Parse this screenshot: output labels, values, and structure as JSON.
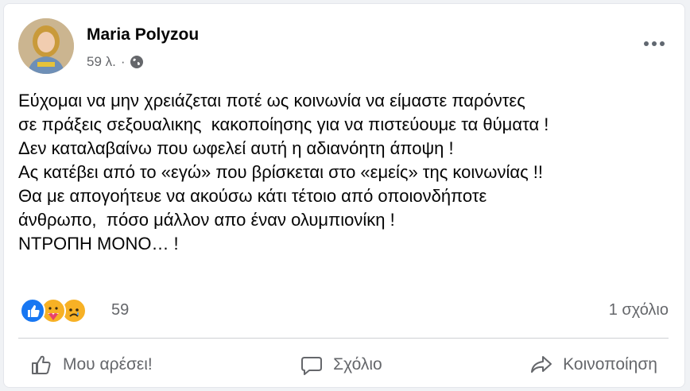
{
  "post": {
    "author": "Maria Polyzou",
    "time": "59 λ.",
    "separator": "·",
    "privacy_icon": "globe-icon",
    "text_lines": [
      "Εύχομαι να μην χρειάζεται ποτέ ως κοινωνία να είμαστε παρόντες",
      "σε πράξεις σεξουαλικης  κακοποίησης για να πιστεύουμε τα θύματα !",
      "Δεν καταλαβαίνω που ωφελεί αυτή η αδιανόητη άποψη !",
      "Ας κατέβει από το «εγώ» που βρίσκεται στο «εμείς» της κοινωνίας !!",
      "Θα με απογοήτευε να ακούσω κάτι τέτοιο από οποιονδήποτε",
      "άνθρωπο,  πόσο μάλλον απο έναν ολυμπιονίκη !",
      "ΝΤΡΟΠΗ ΜΟΝΟ… !"
    ]
  },
  "engagement": {
    "reaction_icons": [
      "like-icon",
      "care-icon",
      "sad-icon"
    ],
    "reaction_count": "59",
    "comment_count": "1 σχόλιο"
  },
  "actions": {
    "like_label": "Μου αρέσει!",
    "comment_label": "Σχόλιο",
    "share_label": "Κοινοποίηση"
  },
  "colors": {
    "secondary_text": "#65676b",
    "like_blue": "#1877f2",
    "emoji_yellow": "#f7b125",
    "divider": "#ced0d4"
  }
}
